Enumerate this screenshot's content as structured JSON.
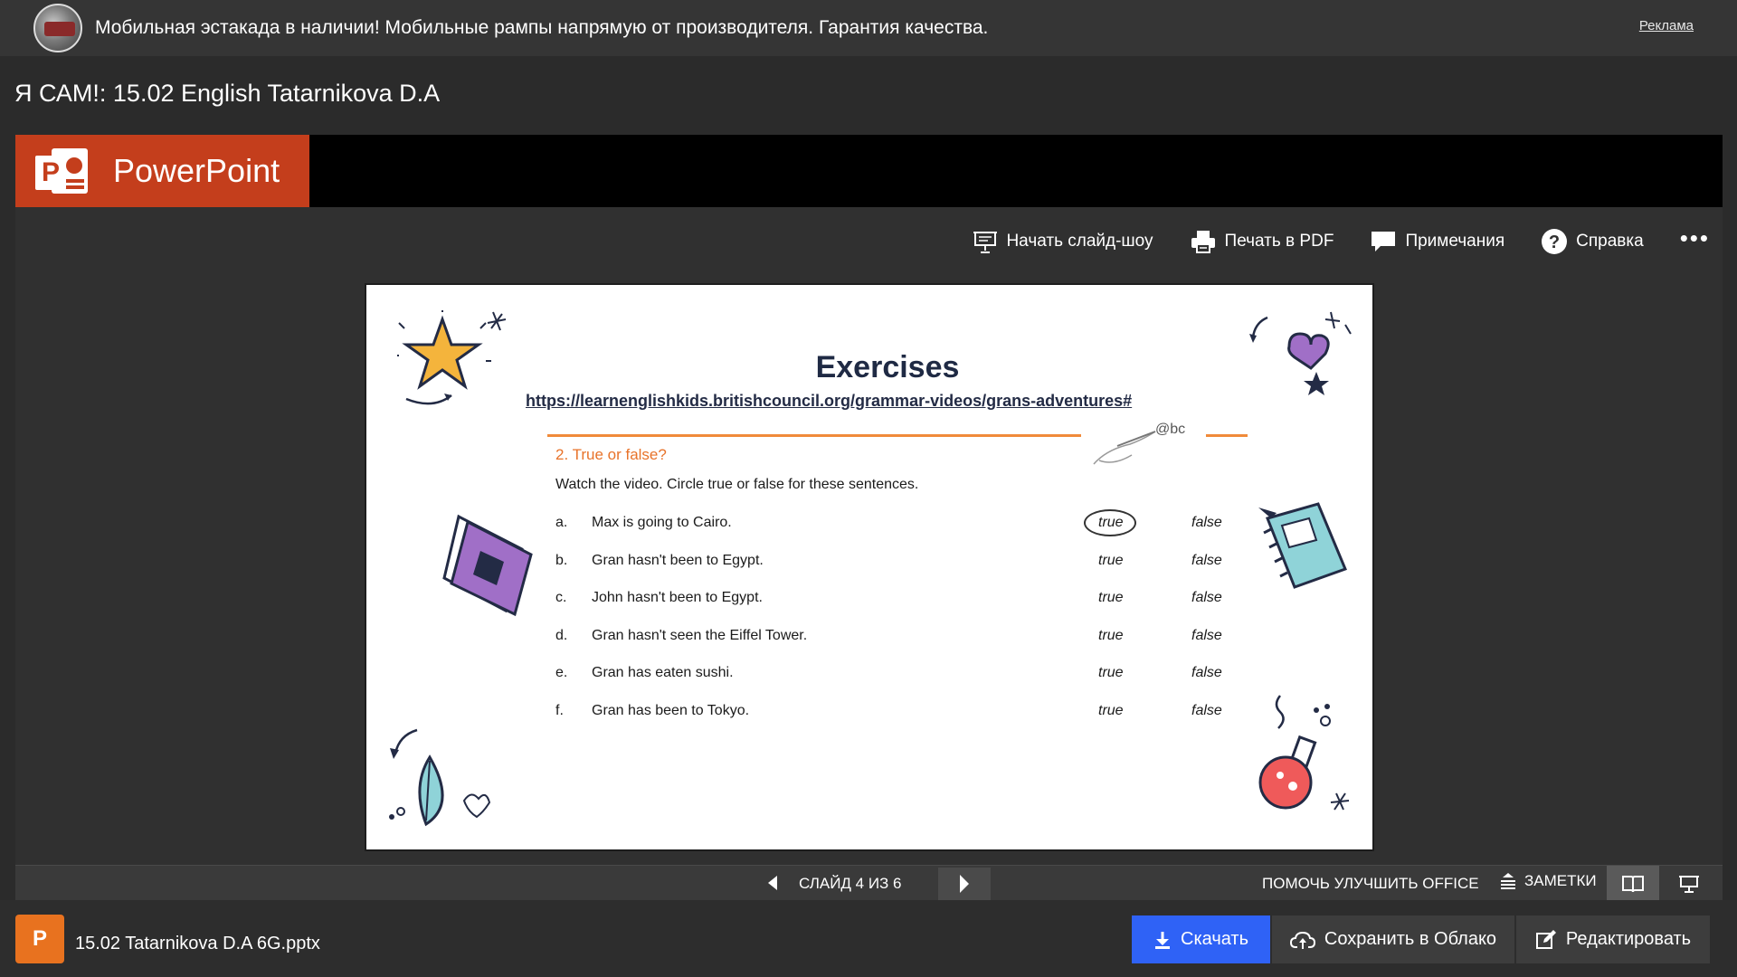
{
  "ad": {
    "text": "Мобильная эстакада в наличии!  Мобильные рампы напрямую от производителя. Гарантия качества.",
    "label": "Реклама"
  },
  "page": {
    "title": "Я САМ!: 15.02 English Tatarnikova D.A"
  },
  "viewer": {
    "app_name": "PowerPoint",
    "toolbar": {
      "slideshow": "Начать слайд-шоу",
      "print": "Печать в PDF",
      "notes": "Примечания",
      "help": "Справка",
      "more": "•••"
    },
    "slide": {
      "title": "Exercises",
      "link": "https://learnenglishkids.britishcouncil.org/grammar-videos/grans-adventures#",
      "handwriting": "@bc",
      "subtitle": "2. True or false?",
      "instruction": "Watch the video. Circle true or false for these sentences.",
      "rows": [
        {
          "letter": "a.",
          "sentence": "Max is going to Cairo.",
          "t": "true",
          "f": "false",
          "circled": "true"
        },
        {
          "letter": "b.",
          "sentence": "Gran hasn't been to Egypt.",
          "t": "true",
          "f": "false"
        },
        {
          "letter": "c.",
          "sentence": "John hasn't been to Egypt.",
          "t": "true",
          "f": "false"
        },
        {
          "letter": "d.",
          "sentence": "Gran hasn't seen the Eiffel Tower.",
          "t": "true",
          "f": "false"
        },
        {
          "letter": "e.",
          "sentence": "Gran has eaten sushi.",
          "t": "true",
          "f": "false"
        },
        {
          "letter": "f.",
          "sentence": "Gran has been to Tokyo.",
          "t": "true",
          "f": "false"
        }
      ]
    },
    "status": {
      "counter": "СЛАЙД 4 ИЗ 6",
      "help_office": "ПОМОЧЬ УЛУЧШИТЬ OFFICE",
      "notes": "ЗАМЕТКИ"
    }
  },
  "file": {
    "name": "15.02 Tatarnikova D.A 6G.pptx",
    "icon_letter": "P",
    "download": "Скачать",
    "save_cloud": "Сохранить в Облако",
    "edit": "Редактировать"
  },
  "colors": {
    "ppt_brand": "#c43e1c",
    "download_blue": "#2f62f6",
    "orange_accent": "#f08a3a",
    "file_icon": "#e8721f"
  }
}
